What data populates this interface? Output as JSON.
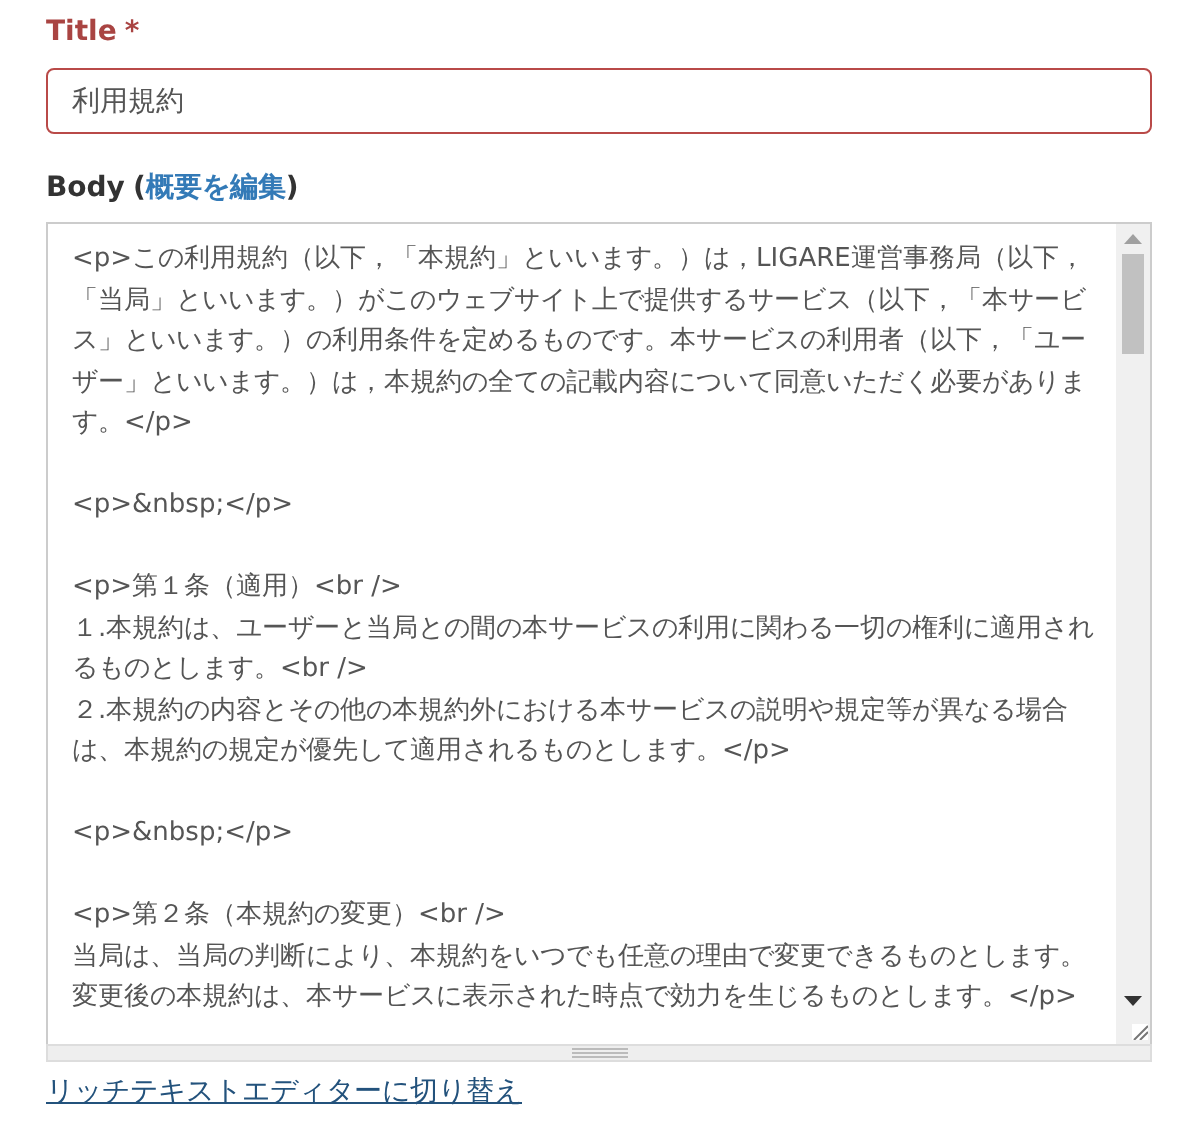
{
  "title_field": {
    "label": "Title",
    "required_mark": "*",
    "value": "利用規約",
    "invalid": true
  },
  "body_field": {
    "label": "Body",
    "paren_open": "(",
    "summary_link": "概要を編集",
    "paren_close": ")",
    "value": "<p>この利用規約（以下，「本規約」といいます。）は，LIGARE運営事務局（以下，「当局」といいます。）がこのウェブサイト上で提供するサービス（以下，「本サービス」といいます。）の利用条件を定めるものです。本サービスの利用者（以下，「ユーザー」といいます。）は，本規約の全ての記載内容について同意いただく必要があります。</p>\n\n<p>&nbsp;</p>\n\n<p>第１条（適用）<br />\n１.本規約は、ユーザーと当局との間の本サービスの利用に関わる一切の権利に適用されるものとします。<br />\n２.本規約の内容とその他の本規約外における本サービスの説明や規定等が異なる場合は、本規約の規定が優先して適用されるものとします。</p>\n\n<p>&nbsp;</p>\n\n<p>第２条（本規約の変更）<br />\n当局は、当局の判断により、本規約をいつでも任意の理由で変更できるものとします。変更後の本規約は、本サービスに表示された時点で効力を生じるものとします。</p>"
  },
  "editor_switch_link": "リッチテキストエディターに切り替え"
}
